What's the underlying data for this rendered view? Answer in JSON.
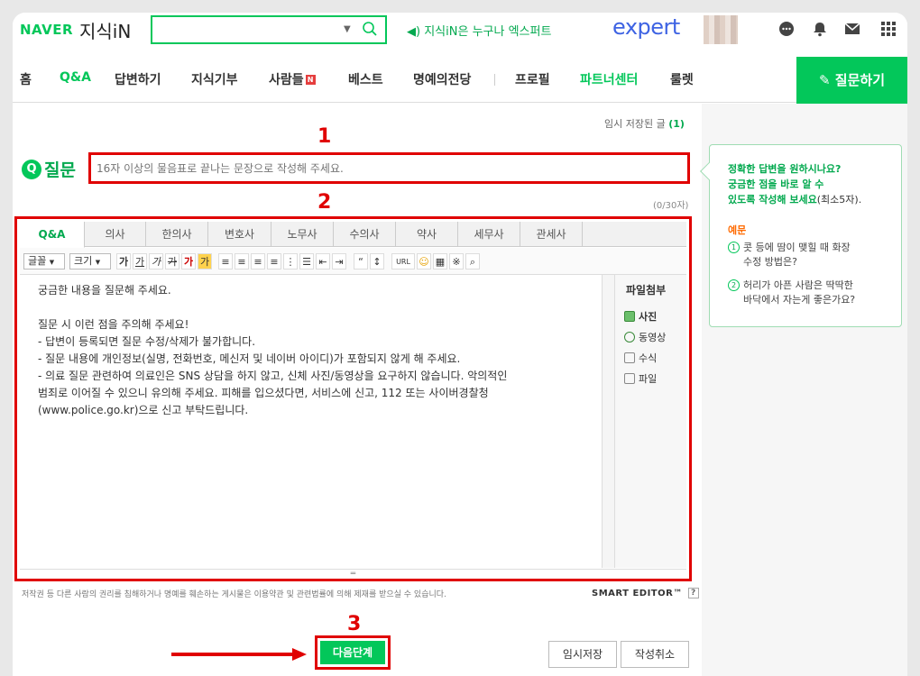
{
  "header": {
    "logo": "NAVER",
    "service": "지식iN",
    "search_placeholder": "",
    "promo": "지식iN은 누구나 엑스퍼트",
    "expert_logo": "expert",
    "icons": [
      "chat-icon",
      "bell-icon",
      "mail-icon",
      "apps-grid-icon"
    ]
  },
  "nav": {
    "items": [
      "홈",
      "Q&A",
      "답변하기",
      "지식기부",
      "사람들",
      "베스트",
      "명예의전당",
      "프로필",
      "파트너센터",
      "룰렛"
    ],
    "badge": "N",
    "ask_button": "질문하기"
  },
  "form": {
    "temp_saved": "임시 저장된 글",
    "temp_saved_count": "(1)",
    "q_icon": "Q",
    "q_label": "질문",
    "title_placeholder": "16자 이상의 물음표로 끝나는 문장으로 작성해 주세요.",
    "char_count": "(0/30자)"
  },
  "annotations": {
    "n1": "1",
    "n2": "2",
    "n3": "3"
  },
  "editor": {
    "tabs": [
      "Q&A",
      "의사",
      "한의사",
      "변호사",
      "노무사",
      "수의사",
      "약사",
      "세무사",
      "관세사"
    ],
    "toolbar": {
      "font_select": "글꼴",
      "size_select": "크기",
      "style_buttons": [
        "가",
        "가",
        "가",
        "가",
        "가",
        "가"
      ],
      "url_button": "URL"
    },
    "body_lines": [
      "궁금한 내용을 질문해 주세요.",
      "",
      "질문 시 이런 점을 주의해 주세요!",
      "- 답변이 등록되면 질문 수정/삭제가 불가합니다.",
      "- 질문 내용에 개인정보(실명, 전화번호, 메신저 및 네이버 아이디)가 포함되지 않게 해 주세요.",
      "- 의료 질문 관련하여 의료인은 SNS 상담을 하지 않고, 신체 사진/동영상을 요구하지 않습니다. 악의적인",
      "범죄로 이어질 수 있으니 유의해 주세요. 피해를 입으셨다면, 서비스에 신고, 112 또는 사이버경찰청",
      "(www.police.go.kr)으로 신고 부탁드립니다."
    ],
    "attach": {
      "title": "파일첨부",
      "items": [
        "사진",
        "동영상",
        "수식",
        "파일"
      ]
    }
  },
  "footer": {
    "copyright": "저작권 등 다른 사람의 권리를 침해하거나 명예를 훼손하는 게시물은 이용약관 및 관련법률에 의해 제재를 받으실 수 있습니다.",
    "smart_editor": "SMART EDITOR™",
    "help": "?",
    "next_button": "다음단계",
    "temp_save_button": "임시저장",
    "cancel_button": "작성취소"
  },
  "tip": {
    "heading_lines": [
      "정확한 답변을 원하시나요?",
      "궁금한 점을 바로 알 수",
      "있도록 작성해 보세요"
    ],
    "heading_suffix": "(최소5자).",
    "example_label": "예문",
    "examples": [
      {
        "num": "1",
        "lines": [
          "콧 등에 땀이 맺힐 때 화장",
          "수정 방법은?"
        ]
      },
      {
        "num": "2",
        "lines": [
          "허리가 아픈 사람은 딱딱한",
          "바닥에서 자는게 좋은가요?"
        ]
      }
    ]
  },
  "colors": {
    "brand": "#03c75a",
    "highlight": "#e00000",
    "expert": "#3e63e3"
  }
}
